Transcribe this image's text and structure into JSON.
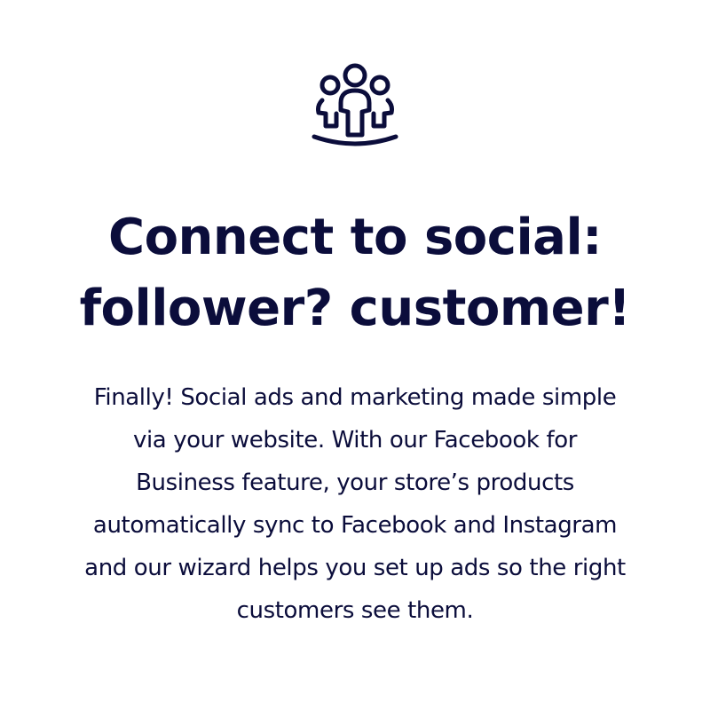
{
  "feature": {
    "icon": "people-group-icon",
    "headline_lines": [
      "Connect to social:",
      "follower? customer!"
    ],
    "body_lines": [
      "Finally! Social ads and marketing made simple",
      "via your website. With our Facebook for",
      "Business feature, your store’s products",
      "automatically sync to Facebook and Instagram",
      "and our wizard helps you set up ads so the right",
      "customers see them."
    ],
    "colors": {
      "text": "#0b0d3b",
      "background": "#ffffff"
    }
  }
}
